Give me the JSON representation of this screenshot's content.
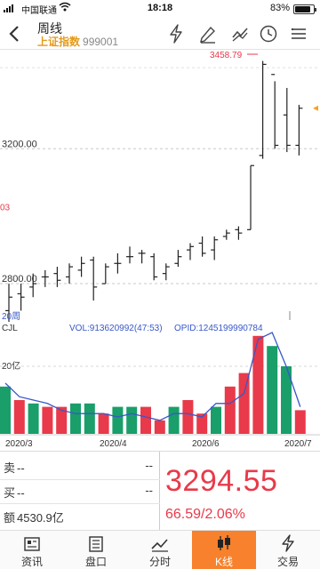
{
  "status_bar": {
    "carrier": "中国联通",
    "time": "18:18",
    "battery_pct": "83%",
    "battery_level": 0.83
  },
  "header": {
    "title": "周线",
    "stock_name": "上证指数",
    "stock_code": "999001",
    "icons": [
      "lightning-icon",
      "pen-icon",
      "drawing-tool-icon",
      "clock-icon",
      "menu-icon"
    ]
  },
  "chart_data": [
    {
      "type": "candlestick",
      "title": "周线",
      "y_labels": [
        "3458.79",
        "3200.00",
        "2800.00",
        "03"
      ],
      "ma_label": "20周",
      "ylim": [
        2700,
        3480
      ],
      "series": [
        {
          "o": 2720,
          "h": 2800,
          "l": 2640,
          "c": 2760
        },
        {
          "o": 2770,
          "h": 2800,
          "l": 2720,
          "c": 2760
        },
        {
          "o": 2790,
          "h": 2830,
          "l": 2760,
          "c": 2800
        },
        {
          "o": 2820,
          "h": 2840,
          "l": 2790,
          "c": 2820
        },
        {
          "o": 2830,
          "h": 2850,
          "l": 2790,
          "c": 2810
        },
        {
          "o": 2820,
          "h": 2860,
          "l": 2800,
          "c": 2850
        },
        {
          "o": 2840,
          "h": 2880,
          "l": 2820,
          "c": 2860
        },
        {
          "o": 2870,
          "h": 2880,
          "l": 2750,
          "c": 2790
        },
        {
          "o": 2800,
          "h": 2860,
          "l": 2800,
          "c": 2850
        },
        {
          "o": 2860,
          "h": 2890,
          "l": 2830,
          "c": 2860
        },
        {
          "o": 2880,
          "h": 2910,
          "l": 2860,
          "c": 2880
        },
        {
          "o": 2890,
          "h": 2900,
          "l": 2860,
          "c": 2890
        },
        {
          "o": 2880,
          "h": 2890,
          "l": 2810,
          "c": 2820
        },
        {
          "o": 2830,
          "h": 2860,
          "l": 2810,
          "c": 2850
        },
        {
          "o": 2860,
          "h": 2900,
          "l": 2850,
          "c": 2880
        },
        {
          "o": 2900,
          "h": 2920,
          "l": 2870,
          "c": 2910
        },
        {
          "o": 2920,
          "h": 2940,
          "l": 2880,
          "c": 2890
        },
        {
          "o": 2900,
          "h": 2940,
          "l": 2870,
          "c": 2930
        },
        {
          "o": 2940,
          "h": 2960,
          "l": 2930,
          "c": 2950
        },
        {
          "o": 2960,
          "h": 2970,
          "l": 2930,
          "c": 2950
        },
        {
          "o": 2960,
          "h": 3150,
          "l": 2960,
          "c": 3150
        },
        {
          "o": 3180,
          "h": 3460,
          "l": 3170,
          "c": 3450
        },
        {
          "o": 3420,
          "h": 3400,
          "l": 3200,
          "c": 3210
        },
        {
          "o": 3300,
          "h": 3380,
          "l": 3190,
          "c": 3210
        },
        {
          "o": 3210,
          "h": 3330,
          "l": 3180,
          "c": 3320
        }
      ]
    },
    {
      "type": "bar",
      "title": "CJL",
      "indicator_text": "VOL:913620992(47:53)",
      "indicator_text2": "OPID:1245199990784",
      "y_labels": [
        "20亿"
      ],
      "x_labels": [
        "2020/3",
        "2020/4",
        "2020/6",
        "2020/7"
      ],
      "values": [
        14,
        10,
        9,
        8,
        8,
        9,
        9,
        6,
        8,
        8,
        8,
        4,
        8,
        10,
        6,
        8,
        14,
        18,
        29,
        26,
        20,
        7
      ],
      "colors": [
        "green",
        "red",
        "green",
        "red",
        "red",
        "green",
        "green",
        "red",
        "green",
        "green",
        "red",
        "red",
        "green",
        "red",
        "red",
        "green",
        "red",
        "red",
        "red",
        "green",
        "green",
        "red"
      ],
      "ma_values": [
        15,
        11,
        10,
        9,
        7,
        6,
        6,
        6,
        5,
        6,
        5,
        4,
        6,
        6,
        5,
        9,
        9,
        12,
        28,
        30,
        20,
        8
      ]
    }
  ],
  "quote": {
    "sell_label": "卖",
    "sell_value": "--",
    "sell_value2": "--",
    "buy_label": "买",
    "buy_value": "--",
    "buy_value2": "--",
    "amount_label": "额",
    "amount_value": "4530.9亿",
    "price": "3294.55",
    "change": "66.59/2.06%"
  },
  "tabs": [
    {
      "label": "资讯",
      "icon": "news-icon"
    },
    {
      "label": "盘口",
      "icon": "order-book-icon"
    },
    {
      "label": "分时",
      "icon": "intraday-icon"
    },
    {
      "label": "K线",
      "icon": "kline-icon",
      "active": true
    },
    {
      "label": "交易",
      "icon": "trade-lightning-icon"
    }
  ],
  "colors": {
    "up": "#e83a4a",
    "down": "#1a9e6a",
    "accent": "#f7812c",
    "stock_name": "#e49a1a",
    "ma_line": "#3858c8"
  }
}
